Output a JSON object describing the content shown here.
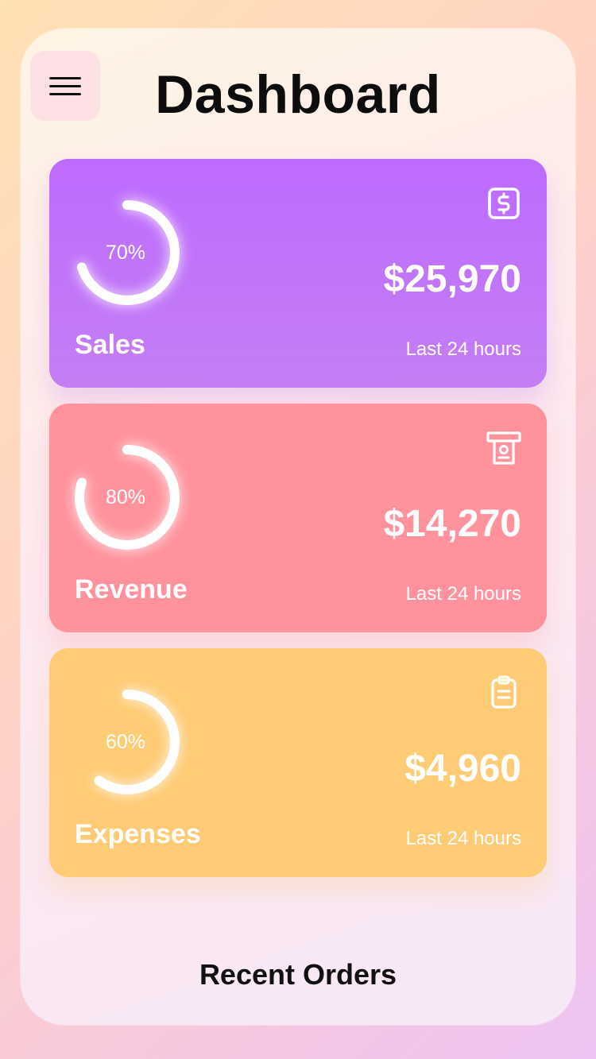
{
  "header": {
    "title": "Dashboard"
  },
  "cards": [
    {
      "label": "Sales",
      "amount": "$25,970",
      "period": "Last 24 hours",
      "percent_text": "70%",
      "percent": 70,
      "icon": "dollar-icon",
      "color": "#bd6bff"
    },
    {
      "label": "Revenue",
      "amount": "$14,270",
      "period": "Last 24 hours",
      "percent_text": "80%",
      "percent": 80,
      "icon": "cash-icon",
      "color": "#ff929d"
    },
    {
      "label": "Expenses",
      "amount": "$4,960",
      "period": "Last 24 hours",
      "percent_text": "60%",
      "percent": 60,
      "icon": "clipboard-icon",
      "color": "#ffcb74"
    }
  ],
  "section": {
    "recent_orders": "Recent Orders"
  }
}
